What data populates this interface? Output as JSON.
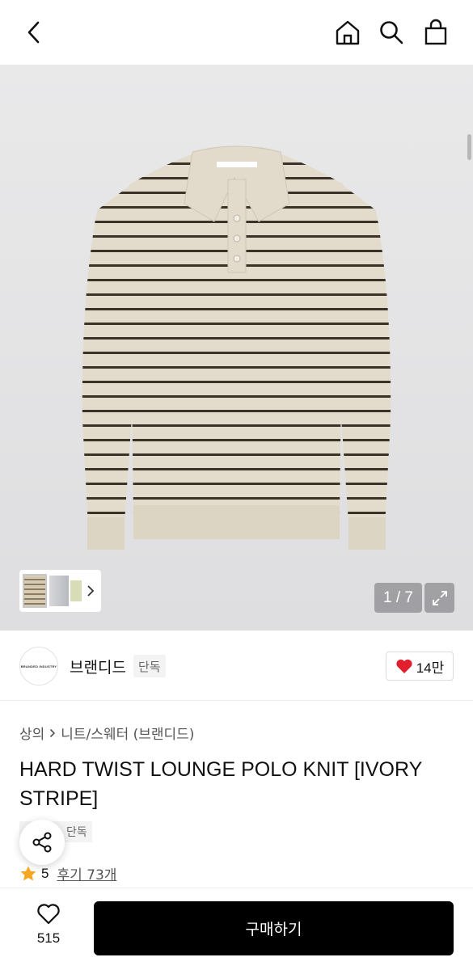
{
  "hero": {
    "pager": "1 / 7"
  },
  "brand": {
    "name": "브랜디드",
    "tag": "단독",
    "logo_text": "BRANDED INDUSTRY"
  },
  "like": {
    "count": "14만"
  },
  "breadcrumb": {
    "category": "상의",
    "subcategory": "니트/스웨터 (브랜디드)"
  },
  "product": {
    "title": "HARD TWIST LOUNGE POLO KNIT [IVORY STRIPE]",
    "tag": "단독",
    "rating": "5",
    "reviews": "후기 73개"
  },
  "bottom": {
    "wish_count": "515",
    "buy_label": "구매하기"
  },
  "colors": {
    "accent": "#000000",
    "heart": "#e0202e",
    "star": "#f5a623"
  },
  "icons": [
    "back-arrow-icon",
    "home-icon",
    "search-icon",
    "shopping-bag-icon",
    "expand-icon",
    "heart-icon",
    "chevron-right-icon",
    "share-icon",
    "star-icon",
    "heart-outline-icon"
  ]
}
